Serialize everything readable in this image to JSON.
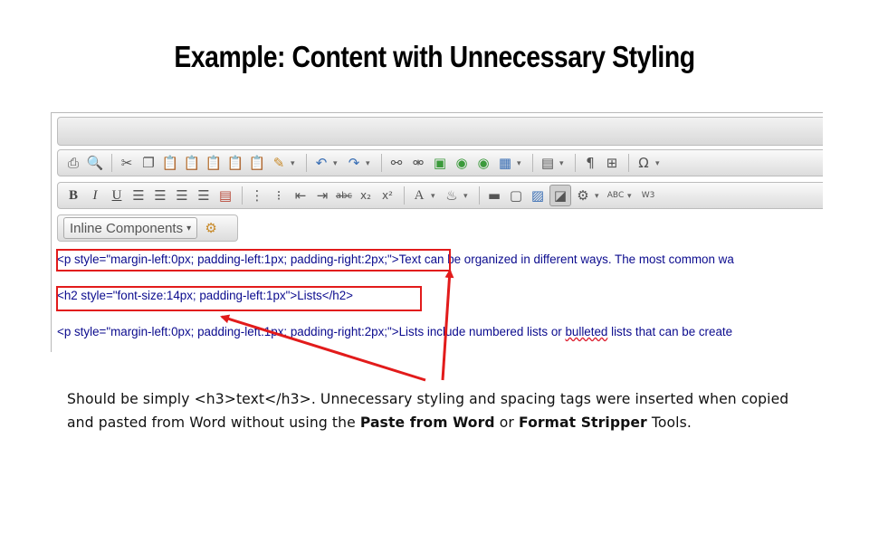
{
  "slide": {
    "title": "Example: Content with Unnecessary Styling"
  },
  "editor": {
    "toolbar1_icons": [
      "print-icon",
      "find-replace-icon",
      "cut-icon",
      "copy-icon",
      "paste-icon",
      "paste-text-icon",
      "paste-word-icon",
      "paste-html-icon",
      "paste-special-icon",
      "format-stripper-icon",
      "undo-icon",
      "redo-icon",
      "link-icon",
      "unlink-icon",
      "image-icon",
      "media-icon",
      "flash-icon",
      "table-icon",
      "template-icon",
      "paragraph-icon",
      "insert-snippet-icon",
      "special-char-icon"
    ],
    "toolbar2_icons": [
      "bold-icon",
      "italic-icon",
      "underline-icon",
      "align-left-icon",
      "align-center-icon",
      "align-right-icon",
      "justify-icon",
      "format-icon",
      "numbered-list-icon",
      "bulleted-list-icon",
      "outdent-icon",
      "indent-icon",
      "strikethrough-icon",
      "subscript-icon",
      "superscript-icon",
      "font-color-icon",
      "highlight-icon",
      "horizontal-rule-icon",
      "show-blocks-icon",
      "image-map-icon",
      "design-mode-icon",
      "tools-icon",
      "spellcheck-icon",
      "w3c-icon"
    ],
    "inline_components_label": "Inline Components",
    "code_line1_tag": "<p style=\"margin-left:0px; padding-left:1px; padding-right:2px;\">",
    "code_line1_text": "Text can be organized in different ways. The most common wa",
    "code_line2": "<h2 style=\"font-size:14px; padding-left:1px\">Lists</h2>",
    "code_line3_tag": "<p style=\"margin-left:0px; padding-left:1px; padding-right:2px;\">",
    "code_line3_text_a": "Lists include numbered lists or ",
    "code_line3_text_b": "bulleted",
    "code_line3_text_c": " lists that can be create"
  },
  "caption": {
    "line1_a": "Should be simply ",
    "line1_code": "<h3>text</h3>",
    "line1_b": ".  Unnecessary styling and spacing tags were inserted when copied and pasted from Word  without using the ",
    "bold1": "Paste from Word",
    "mid": " or ",
    "bold2": "Format Stripper",
    "end": " Tools."
  },
  "colors": {
    "highlight": "#e21b1b",
    "code_text": "#0b0b8e"
  }
}
